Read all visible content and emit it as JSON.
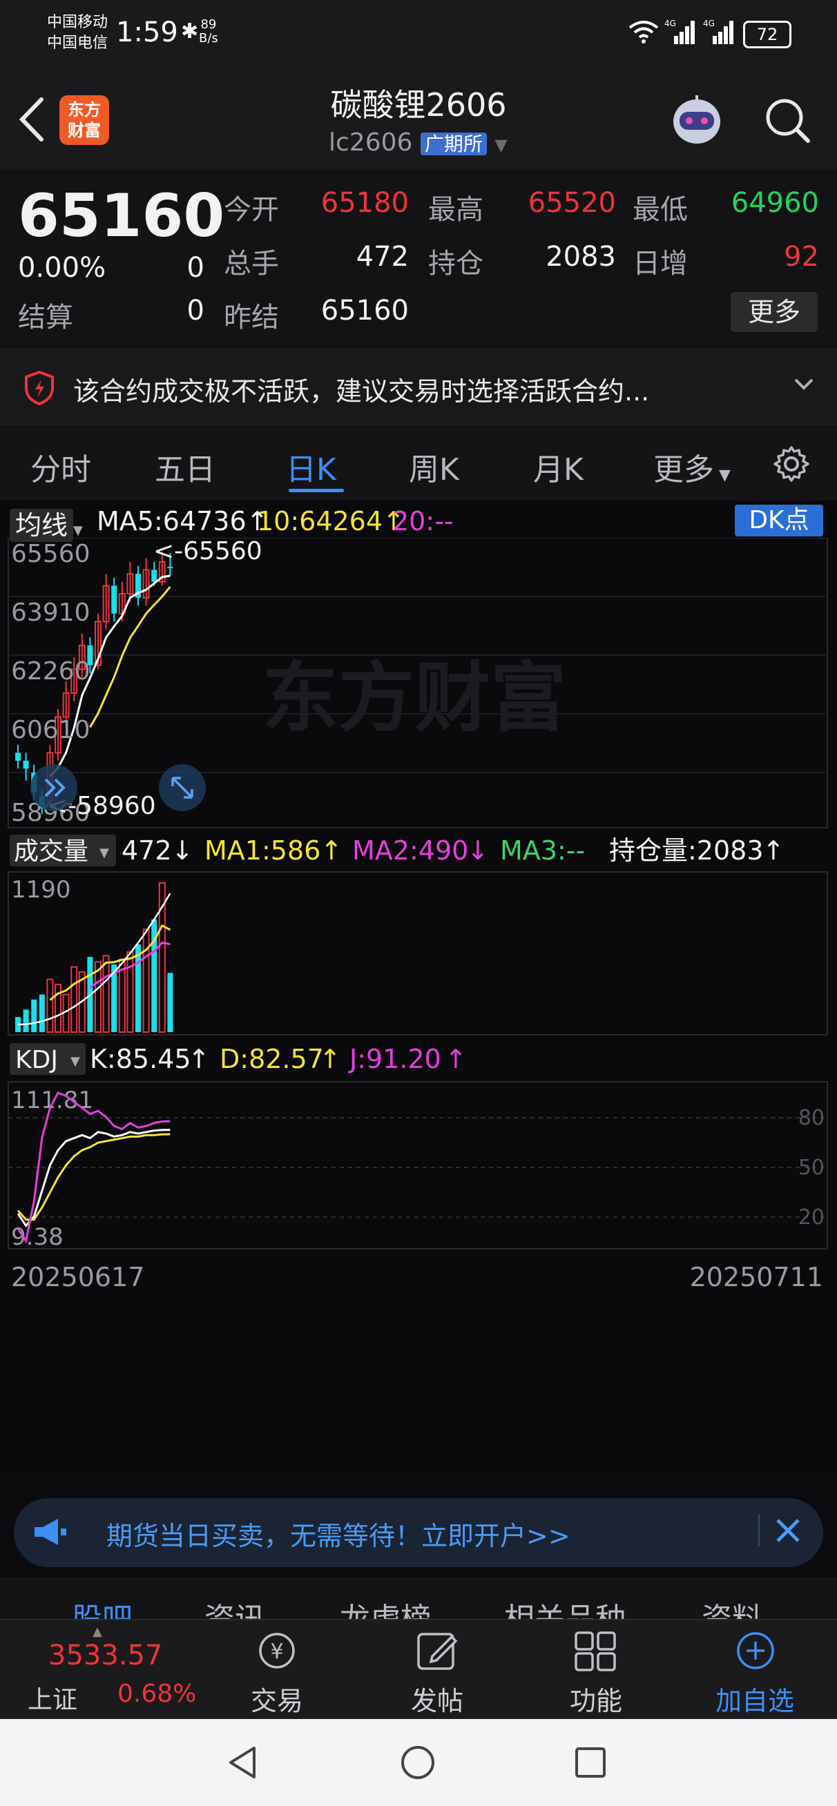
{
  "status_bar": {
    "carrier1": "中国移动",
    "carrier2": "中国电信",
    "time": "1:59",
    "net_speed_value": "89",
    "net_speed_unit": "B/s",
    "battery": "72"
  },
  "header": {
    "title": "碳酸锂2606",
    "code": "lc2606",
    "exchange": "广期所",
    "logo_line1": "东方",
    "logo_line2": "财富"
  },
  "quote": {
    "last_price": "65160",
    "change_pct": "0.00%",
    "change_val": "0",
    "settle_label": "结算",
    "settle_val": "0",
    "open_label": "今开",
    "open_val": "65180",
    "high_label": "最高",
    "high_val": "65520",
    "low_label": "最低",
    "low_val": "64960",
    "volume_label": "总手",
    "volume_val": "472",
    "oi_label": "持仓",
    "oi_val": "2083",
    "daily_inc_label": "日增",
    "daily_inc_val": "92",
    "prev_settle_label": "昨结",
    "prev_settle_val": "65160",
    "more_label": "更多"
  },
  "alert": {
    "text": "该合约成交极不活跃，建议交易时选择活跃合约..."
  },
  "tabs": [
    {
      "label": "分时"
    },
    {
      "label": "五日"
    },
    {
      "label": "日K"
    },
    {
      "label": "周K"
    },
    {
      "label": "月K"
    },
    {
      "label": "更多"
    }
  ],
  "kline": {
    "indicator_label": "均线",
    "ma5": "MA5:64736",
    "ma10": "10:64264",
    "ma20": "20:--",
    "dk_label": "DK点",
    "y_labels": [
      "65560",
      "63910",
      "62260",
      "60610",
      "58960"
    ],
    "max_marker": "<-65560",
    "min_marker": "<-58960",
    "watermark": "东方财富"
  },
  "volume": {
    "indicator_label": "成交量",
    "vol": "472",
    "ma1": "MA1:586",
    "ma2": "MA2:490",
    "ma3": "MA3:--",
    "oi": "持仓量:2083",
    "y_label": "1190"
  },
  "kdj": {
    "indicator_label": "KDJ",
    "k": "K:85.45",
    "d": "D:82.57",
    "j": "J:91.20",
    "y_top": "111.81",
    "y_bottom": "9.38",
    "levels": [
      "80",
      "50",
      "20"
    ]
  },
  "dates": {
    "start": "20250617",
    "end": "20250711"
  },
  "banner": {
    "text": "期货当日买卖，无需等待！立即开户>>"
  },
  "sub_tabs": [
    "股吧",
    "资讯",
    "龙虎榜",
    "相关品种",
    "资料"
  ],
  "bottom_nav": {
    "index_value": "3533.57",
    "index_name": "上证",
    "index_change": "0.68%",
    "items": [
      {
        "label": "交易"
      },
      {
        "label": "发帖"
      },
      {
        "label": "功能"
      },
      {
        "label": "加自选"
      }
    ]
  },
  "colors": {
    "up": "#f0333c",
    "down": "#1ed760",
    "accent": "#3d8ff5",
    "candle_down": "#19e0ee",
    "ma5": "#ffffff",
    "ma10": "#f5e33b",
    "ma20": "#e63fe0"
  }
}
